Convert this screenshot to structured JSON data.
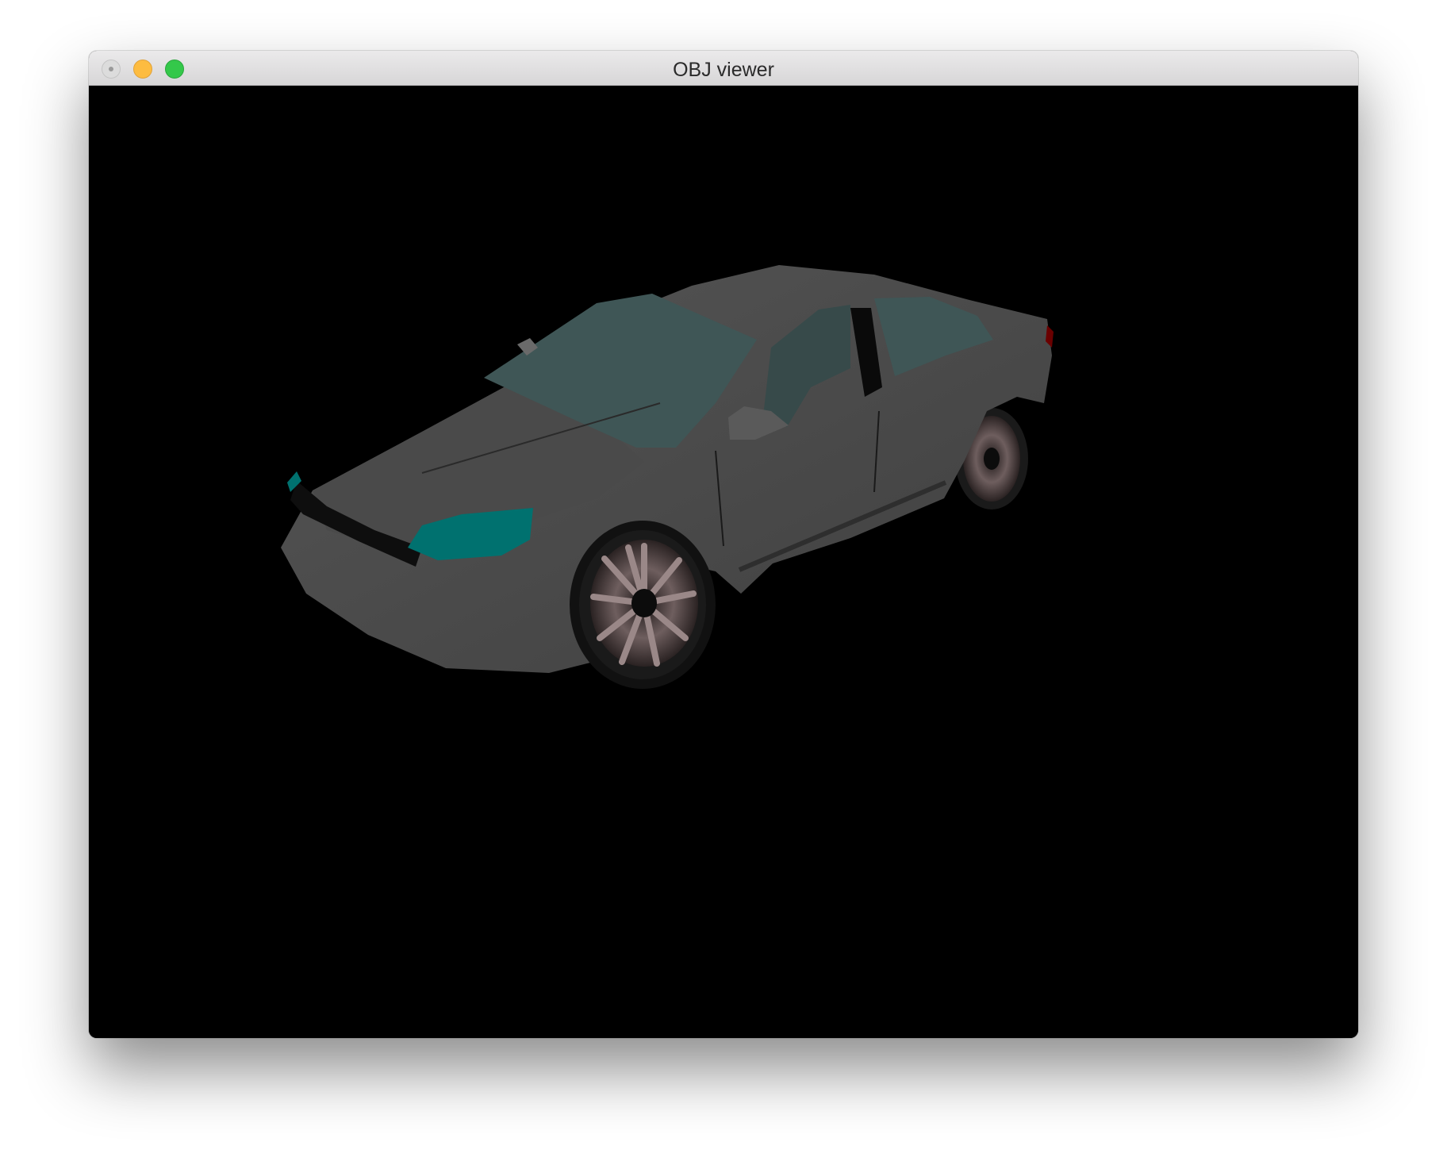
{
  "window": {
    "title": "OBJ viewer"
  },
  "icons": {
    "close": "close-button-icon",
    "minimize": "minimize-button-icon",
    "maximize": "zoom-button-icon"
  },
  "colors": {
    "viewport_background": "#000000",
    "car_body": "#4d4d4d",
    "glass": "#3f5656",
    "headlight": "#00716f",
    "rim": "#8a7a7a"
  }
}
